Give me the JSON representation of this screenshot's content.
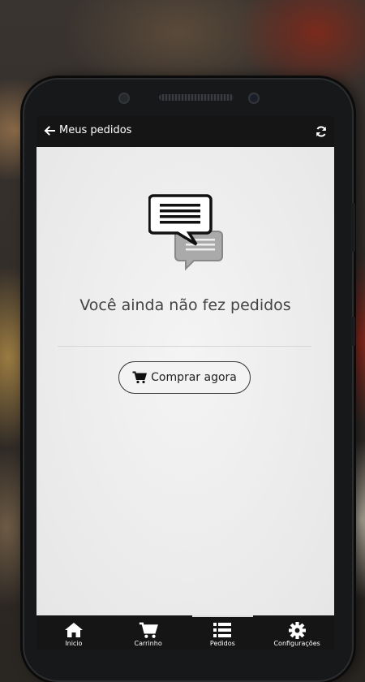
{
  "header": {
    "title": "Meus pedidos",
    "back_icon": "arrow-left-icon",
    "refresh_icon": "refresh-icon"
  },
  "empty_state": {
    "icon": "chat-bubbles-icon",
    "message": "Você ainda não fez pedidos",
    "button_label": "Comprar agora",
    "button_icon": "cart-icon"
  },
  "bottom_nav": {
    "items": [
      {
        "label": "Inicio",
        "icon": "home-icon"
      },
      {
        "label": "Carrinho",
        "icon": "cart-icon"
      },
      {
        "label": "Pedidos",
        "icon": "list-icon",
        "active": true
      },
      {
        "label": "Configurações",
        "icon": "gear-icon"
      }
    ]
  },
  "colors": {
    "bar": "#151515",
    "screen_bg": "#ededed",
    "text": "#444444"
  }
}
